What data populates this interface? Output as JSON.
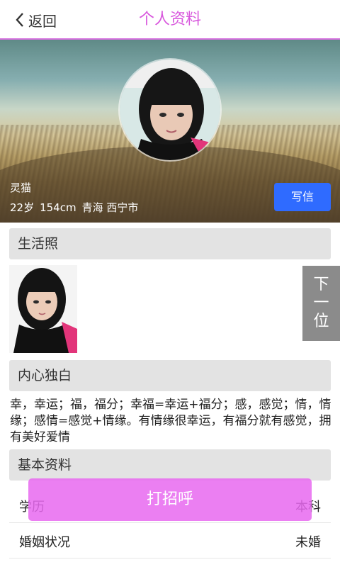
{
  "header": {
    "back_label": "返回",
    "title": "个人资料"
  },
  "profile": {
    "name": "灵猫",
    "age": "22岁",
    "height": "154cm",
    "location": "青海 西宁市",
    "write_label": "写信"
  },
  "sections": {
    "photos_title": "生活照",
    "bio_title": "内心独白",
    "basic_title": "基本资料"
  },
  "bio_text": "幸，幸运；福，福分；幸福=幸运+福分；感，感觉；情，情缘；感情=感觉+情缘。有情缘很幸运，有福分就有感觉，拥有美好爱情",
  "next": {
    "l1": "下",
    "l2": "一",
    "l3": "位"
  },
  "basic": [
    {
      "label": "学历",
      "value": "本科"
    },
    {
      "label": "婚姻状况",
      "value": "未婚"
    }
  ],
  "greet_label": "打招呼",
  "colors": {
    "accent": "#d857dd",
    "write_button": "#2f6bff",
    "greet_button": "#e868f0"
  }
}
